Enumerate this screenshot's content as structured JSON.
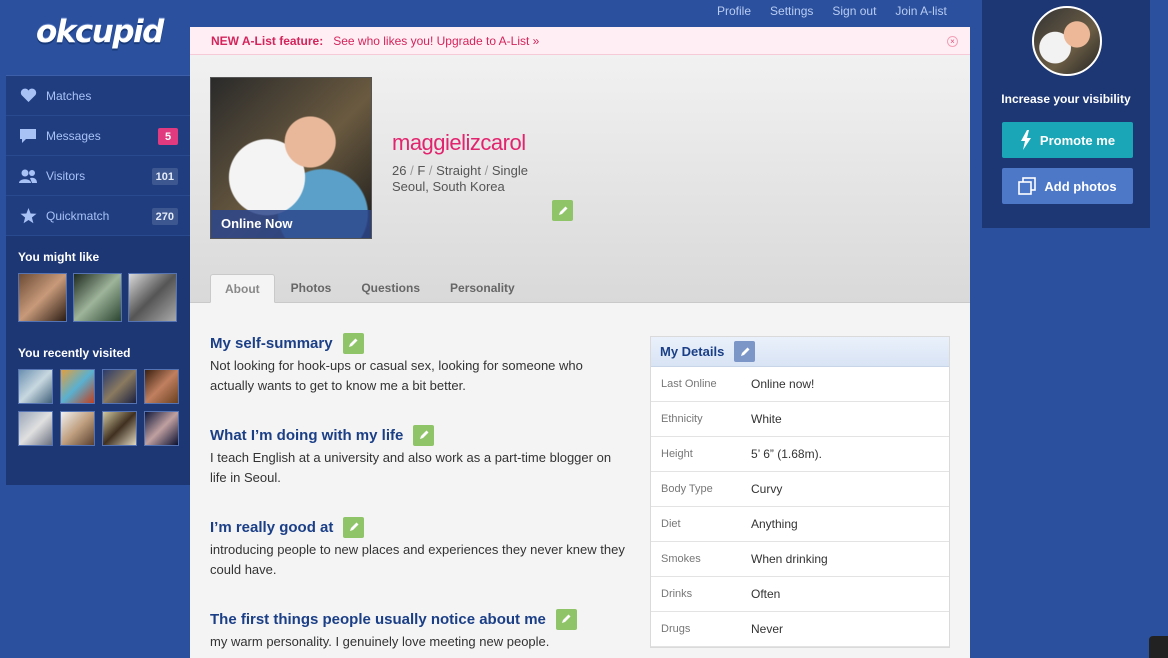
{
  "logo": "okcupid",
  "topnav": [
    "Profile",
    "Settings",
    "Sign out",
    "Join A-list"
  ],
  "alert": {
    "label": "NEW A-List feature:",
    "link": "See who likes you! Upgrade to A-List »",
    "close": "×"
  },
  "sidebar": {
    "items": [
      {
        "label": "Matches",
        "icon": "heart-icon",
        "count": ""
      },
      {
        "label": "Messages",
        "icon": "message-icon",
        "count": "5"
      },
      {
        "label": "Visitors",
        "icon": "visitors-icon",
        "count": "101"
      },
      {
        "label": "Quickmatch",
        "icon": "star-icon",
        "count": "270"
      }
    ],
    "might_like": "You might like",
    "recently_visited": "You recently visited"
  },
  "profile": {
    "online": "Online Now",
    "username": "maggielizcarol",
    "age": "26",
    "gender": "F",
    "orientation": "Straight",
    "status": "Single",
    "location": "Seoul, South Korea"
  },
  "tabs": [
    "About",
    "Photos",
    "Questions",
    "Personality"
  ],
  "essays": [
    {
      "title": "My self-summary",
      "text": "Not looking for hook-ups or casual sex, looking for someone who actually wants to get to know me a bit better."
    },
    {
      "title": "What I’m doing with my life",
      "text": "I teach English at a university and also work as a part-time blogger on life in Seoul."
    },
    {
      "title": "I’m really good at",
      "text": "introducing people to new places and experiences they never knew they could have."
    },
    {
      "title": "The first things people usually notice about me",
      "text": "my warm personality. I genuinely love meeting new people."
    }
  ],
  "details": {
    "title": "My Details",
    "rows": [
      {
        "k": "Last Online",
        "v": "Online now!"
      },
      {
        "k": "Ethnicity",
        "v": "White"
      },
      {
        "k": "Height",
        "v": "5’ 6” (1.68m)."
      },
      {
        "k": "Body Type",
        "v": "Curvy"
      },
      {
        "k": "Diet",
        "v": "Anything"
      },
      {
        "k": "Smokes",
        "v": "When drinking"
      },
      {
        "k": "Drinks",
        "v": "Often"
      },
      {
        "k": "Drugs",
        "v": "Never"
      }
    ]
  },
  "right": {
    "visibility": "Increase your visibility",
    "promote": "Promote me",
    "add_photos": "Add photos"
  },
  "colors": {
    "brand_blue": "#2b509d",
    "pink": "#e2246e",
    "edit_green": "#8fc568",
    "teal": "#1aa6b7"
  }
}
